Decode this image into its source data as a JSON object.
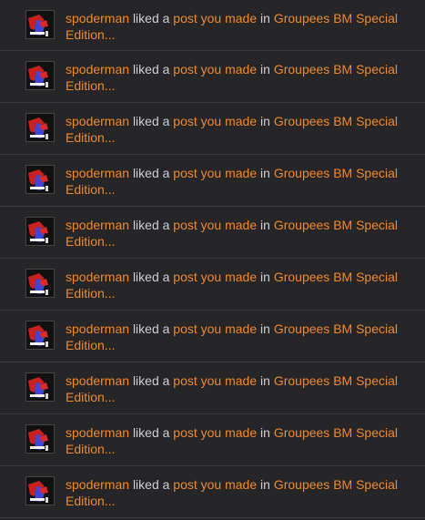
{
  "colors": {
    "background": "#262629",
    "divider": "#3b3b40",
    "link": "#f0882a",
    "text": "#cfcfd2"
  },
  "notifications": [
    {
      "user": "spoderman",
      "action": "liked a",
      "object": "post you made",
      "preposition": "in",
      "topic_line1": "Groupees BM Special",
      "topic_line2": "Edition...",
      "avatar_icon": "spiderman-avatar-icon"
    },
    {
      "user": "spoderman",
      "action": "liked a",
      "object": "post you made",
      "preposition": "in",
      "topic_line1": "Groupees BM Special",
      "topic_line2": "Edition...",
      "avatar_icon": "spiderman-avatar-icon"
    },
    {
      "user": "spoderman",
      "action": "liked a",
      "object": "post you made",
      "preposition": "in",
      "topic_line1": "Groupees BM Special",
      "topic_line2": "Edition...",
      "avatar_icon": "spiderman-avatar-icon"
    },
    {
      "user": "spoderman",
      "action": "liked a",
      "object": "post you made",
      "preposition": "in",
      "topic_line1": "Groupees BM Special",
      "topic_line2": "Edition...",
      "avatar_icon": "spiderman-avatar-icon"
    },
    {
      "user": "spoderman",
      "action": "liked a",
      "object": "post you made",
      "preposition": "in",
      "topic_line1": "Groupees BM Special",
      "topic_line2": "Edition...",
      "avatar_icon": "spiderman-avatar-icon"
    },
    {
      "user": "spoderman",
      "action": "liked a",
      "object": "post you made",
      "preposition": "in",
      "topic_line1": "Groupees BM Special",
      "topic_line2": "Edition...",
      "avatar_icon": "spiderman-avatar-icon"
    },
    {
      "user": "spoderman",
      "action": "liked a",
      "object": "post you made",
      "preposition": "in",
      "topic_line1": "Groupees BM Special",
      "topic_line2": "Edition...",
      "avatar_icon": "spiderman-avatar-icon"
    },
    {
      "user": "spoderman",
      "action": "liked a",
      "object": "post you made",
      "preposition": "in",
      "topic_line1": "Groupees BM Special",
      "topic_line2": "Edition...",
      "avatar_icon": "spiderman-avatar-icon"
    },
    {
      "user": "spoderman",
      "action": "liked a",
      "object": "post you made",
      "preposition": "in",
      "topic_line1": "Groupees BM Special",
      "topic_line2": "Edition...",
      "avatar_icon": "spiderman-avatar-icon"
    },
    {
      "user": "spoderman",
      "action": "liked a",
      "object": "post you made",
      "preposition": "in",
      "topic_line1": "Groupees BM Special",
      "topic_line2": "Edition...",
      "avatar_icon": "spiderman-avatar-icon"
    }
  ]
}
